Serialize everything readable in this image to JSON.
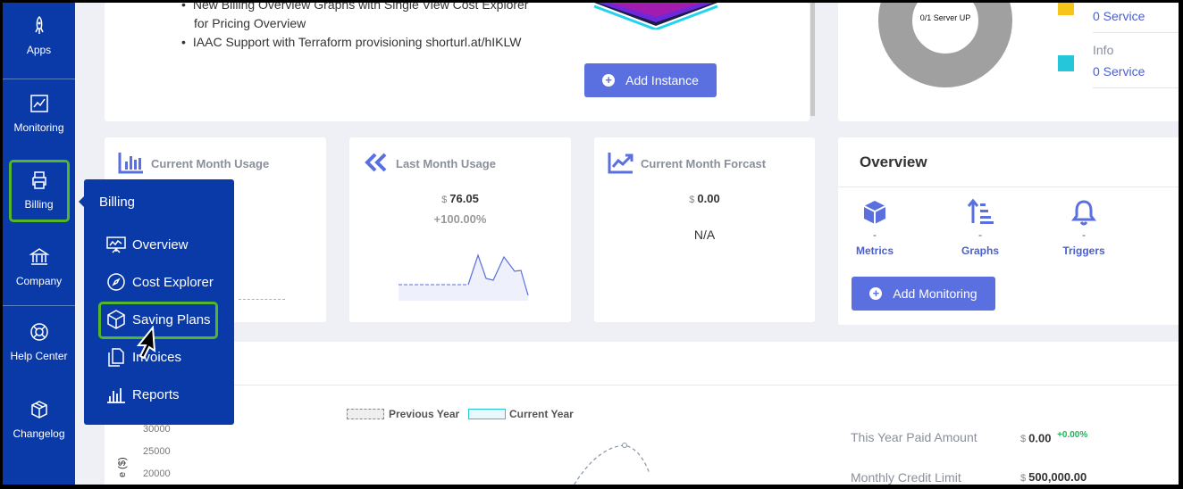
{
  "sidebar": {
    "items": [
      {
        "label": "Apps"
      },
      {
        "label": "Monitoring"
      },
      {
        "label": "Billing"
      },
      {
        "label": "Company"
      },
      {
        "label": "Help Center"
      },
      {
        "label": "Changelog"
      }
    ]
  },
  "flyout": {
    "title": "Billing",
    "items": [
      {
        "label": "Overview"
      },
      {
        "label": "Cost Explorer"
      },
      {
        "label": "Saving Plans"
      },
      {
        "label": "Invoices"
      },
      {
        "label": "Reports"
      }
    ]
  },
  "announcements": {
    "items": [
      "New Billing Overview Graphs with Single View Cost Explorer",
      "for Pricing Overview",
      "IAAC Support with Terraform provisioning shorturl.at/hIKLW"
    ],
    "add_instance_label": "Add Instance"
  },
  "server_status": {
    "donut_label": "0/1 Server UP",
    "legend": [
      {
        "title": "",
        "value": "0 Service",
        "color": "#f5c518"
      },
      {
        "title": "Info",
        "value": "0 Service",
        "color": "#26c6da"
      }
    ]
  },
  "stats": [
    {
      "title": "Current Month Usage"
    },
    {
      "title": "Last Month Usage",
      "currency": "$",
      "value": "76.05",
      "change": "+100.00%"
    },
    {
      "title": "Current Month Forcast",
      "currency": "$",
      "value": "0.00",
      "note": "N/A"
    }
  ],
  "overview": {
    "title": "Overview",
    "items": [
      {
        "label": "Metrics",
        "dash": "-"
      },
      {
        "label": "Graphs",
        "dash": "-"
      },
      {
        "label": "Triggers",
        "dash": "-"
      }
    ],
    "add_monitoring_label": "Add Monitoring"
  },
  "chart": {
    "legend_previous": "Previous Year",
    "legend_current": "Current Year",
    "y_ticks": [
      "30000",
      "25000",
      "20000"
    ],
    "ylabel_fragment": "e ($)"
  },
  "summary": {
    "paid_label": "This Year Paid Amount",
    "paid_currency": "$",
    "paid_value": "0.00",
    "paid_change": "+0.00%",
    "credit_label": "Monthly Credit Limit",
    "credit_currency": "$",
    "credit_value": "500,000.00"
  },
  "colors": {
    "sidebar_bg": "#0a3aa8",
    "accent": "#5a6fe0",
    "highlight": "#52b52a",
    "positive": "#22b35e"
  }
}
